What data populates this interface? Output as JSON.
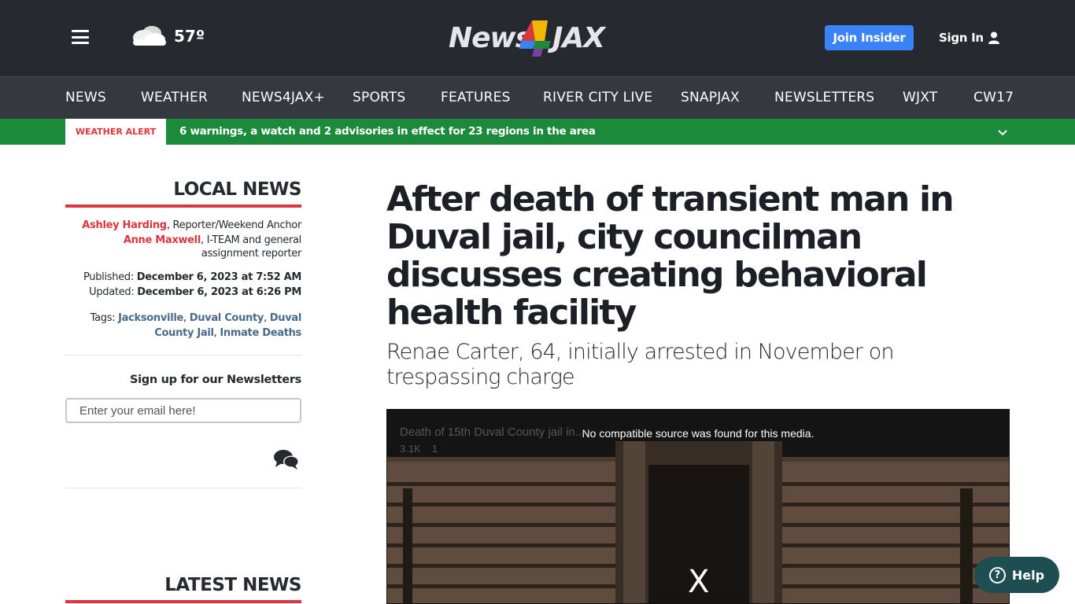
{
  "header": {
    "weather_temp": "57º",
    "weather_icon": "cloudy-icon",
    "logo_text": "News4JAX",
    "join_label": "Join Insider",
    "signin_label": "Sign In"
  },
  "nav": {
    "items": [
      "NEWS",
      "WEATHER",
      "NEWS4JAX+",
      "SPORTS",
      "FEATURES",
      "RIVER CITY LIVE",
      "SNAPJAX",
      "NEWSLETTERS",
      "WJXT",
      "CW17"
    ]
  },
  "alert": {
    "tag": "WEATHER ALERT",
    "text": "6 warnings, a watch and 2 advisories in effect for 23 regions in the area"
  },
  "sidebar": {
    "section_title": "LOCAL NEWS",
    "authors": [
      {
        "name": "Ashley Harding",
        "role": ", Reporter/Weekend Anchor"
      },
      {
        "name": "Anne Maxwell",
        "role": ", I-TEAM and general assignment reporter"
      }
    ],
    "published_label": "Published: ",
    "published_date": "December 6, 2023 at 7:52 AM",
    "updated_label": "Updated: ",
    "updated_date": "December 6, 2023 at 6:26 PM",
    "tags_label": "Tags: ",
    "tags": [
      "Jacksonville",
      "Duval County",
      "Duval County Jail",
      "Inmate Deaths"
    ],
    "newsletter_title": "Sign up for our Newsletters",
    "email_placeholder": "Enter your email here!",
    "latest_title": "LATEST NEWS"
  },
  "article": {
    "headline": "After death of transient man in Duval jail, city councilman discusses creating behavioral health facility",
    "subhead": "Renae Carter, 64, initially arrested in November on trespassing charge"
  },
  "video": {
    "message": "No compatible source was found for this media.",
    "ghost_title": "Death of 15th Duval County jail in...",
    "ghost_views": "3.1K",
    "ghost_likes": "1",
    "close_label": "X"
  },
  "help": {
    "label": "Help"
  },
  "colors": {
    "header_bg": "#262930",
    "nav_bg": "#35383f",
    "alert_green": "#1b8a3b",
    "accent_red": "#d9363e",
    "button_blue": "#3a82f7",
    "help_teal": "#1f4e52"
  }
}
